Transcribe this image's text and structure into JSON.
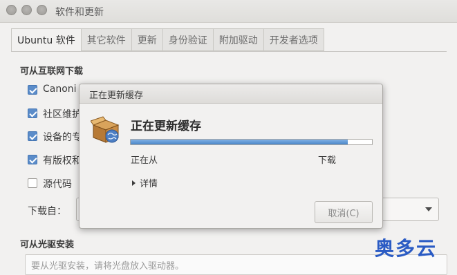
{
  "window": {
    "title": "软件和更新"
  },
  "tabs": [
    {
      "label": "Ubuntu 软件"
    },
    {
      "label": "其它软件"
    },
    {
      "label": "更新"
    },
    {
      "label": "身份验证"
    },
    {
      "label": "附加驱动"
    },
    {
      "label": "开发者选项"
    }
  ],
  "internet_section": {
    "heading": "可从互联网下载",
    "checkboxes": [
      {
        "label": "Canoni",
        "checked": true
      },
      {
        "label": "社区维护",
        "checked": true
      },
      {
        "label": "设备的专",
        "checked": true
      },
      {
        "label": "有版权和",
        "checked": true
      },
      {
        "label": "源代码",
        "checked": false
      }
    ],
    "download_from_label": "下载自："
  },
  "cdrom_section": {
    "heading": "可从光驱安装",
    "placeholder": "要从光驱安装，请将光盘放入驱动器。"
  },
  "dialog": {
    "title": "正在更新缓存",
    "heading": "正在更新缓存",
    "progress_fraction": 0.9,
    "status_left": "正在从",
    "status_right": "下载",
    "details_label": "详情",
    "cancel_label": "取消(C)"
  },
  "watermark": "奥多云",
  "colors": {
    "accent": "#4a86c8",
    "checkbox": "#5b8cc9",
    "watermark": "#2a5bc4"
  }
}
